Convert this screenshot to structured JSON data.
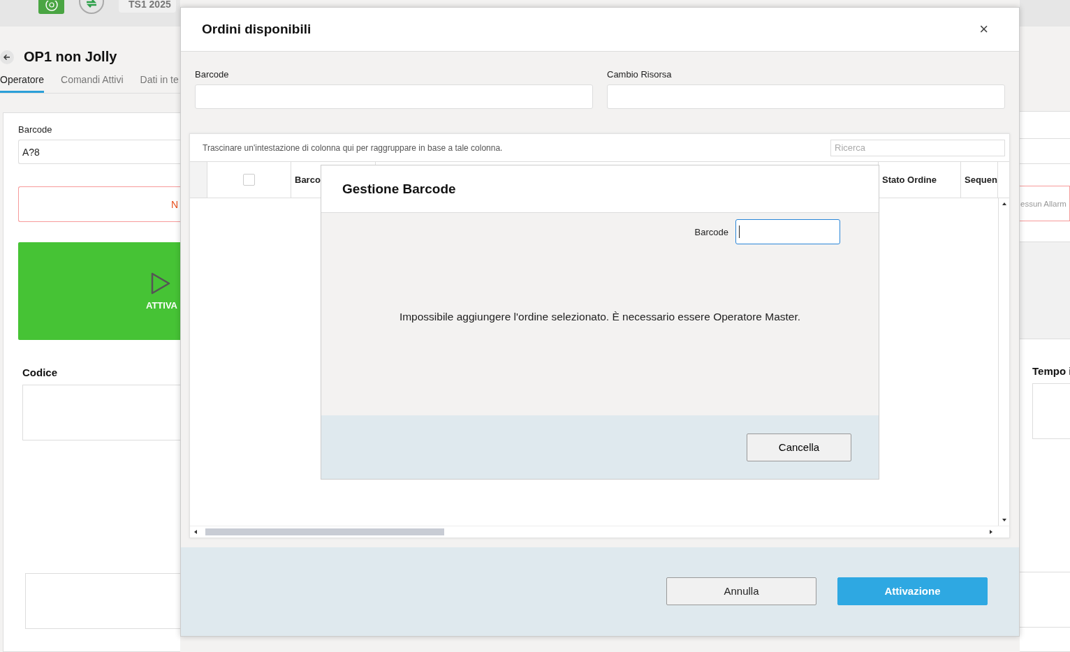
{
  "top_bar": {
    "badge": "TS1 2025"
  },
  "page": {
    "title": "OP1 non Jolly",
    "tabs": [
      {
        "label": "Operatore",
        "selected": true
      },
      {
        "label": "Comandi Attivi",
        "selected": false
      },
      {
        "label": "Dati in te",
        "selected": false
      }
    ],
    "barcode": {
      "label": "Barcode",
      "value": "A?8"
    },
    "alarm_left": "N",
    "alarm_right": "essun Allarm",
    "activate_button": "ATTIVA",
    "codice_label": "Codice",
    "tempo_label": "Tempo i"
  },
  "modal": {
    "title": "Ordini disponibili",
    "close": "×",
    "fields": [
      {
        "label": "Barcode"
      },
      {
        "label": "Cambio Risorsa"
      }
    ],
    "grid": {
      "group_hint": "Trascinare un'intestazione di colonna qui per raggruppare in base a tale colonna.",
      "search_placeholder": "Ricerca",
      "select_all_checked": false,
      "columns": [
        "Barco",
        "Stato Ordine",
        "Sequen"
      ]
    },
    "buttons": [
      {
        "label": "Annulla",
        "kind": "secondary"
      },
      {
        "label": "Attivazione",
        "kind": "primary"
      }
    ]
  },
  "dialog": {
    "title": "Gestione Barcode",
    "field_label": "Barcode",
    "message": "Impossibile aggiungere l'ordine selezionato. È necessario essere Operatore Master.",
    "button": "Cancella"
  }
}
